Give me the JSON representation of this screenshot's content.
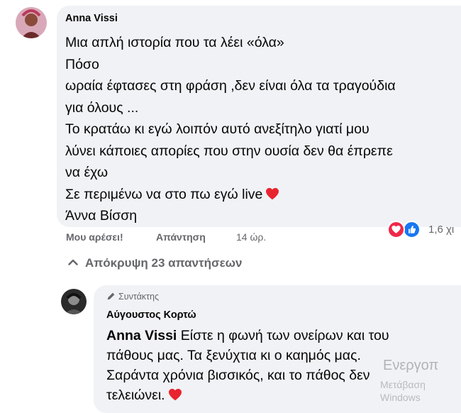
{
  "comment1": {
    "author": "Anna Vissi",
    "lines": [
      "Μια απλή ιστορία που τα λέει «όλα»",
      "Πόσο",
      "ωραία έφτασες στη φράση ,δεν είναι όλα τα τραγούδια",
      "για όλους ...",
      "Το κρατάω κι εγώ λοιπόν αυτό ανεξίτηλο γιατί μου",
      "λύνει κάποιες απορίες που στην ουσία δεν θα έπρεπε",
      "να έχω",
      "Σε περιμένω να στο πω εγώ live",
      "Άννα Βίσση"
    ],
    "actions": {
      "like": "Μου αρέσει!",
      "reply": "Απάντηση",
      "time": "14 ώρ."
    },
    "reactions": {
      "icons": [
        "heart-icon",
        "like-icon"
      ],
      "count": "1,6 χι"
    }
  },
  "hide_replies": "Απόκρυψη 23 απαντήσεων",
  "comment2": {
    "badge": "Συντάκτης",
    "author": "Αύγουστος Κορτώ",
    "mention": "Anna Vissi",
    "lines": [
      " Είστε η φωνή των ονείρων και του",
      "πάθους μας. Τα ξενύχτια κι ο καημός μας.",
      "Σαράντα χρόνια βισσικός, και το πάθος δεν",
      "τελειώνει."
    ]
  },
  "watermark": {
    "line1": "Ενεργοπ",
    "line2": "Μετάβαση",
    "line3": "Windows"
  },
  "colors": {
    "bubble": "#f0f2f5",
    "secondary_text": "#65676b",
    "heart": "#f02849",
    "like": "#1877f2"
  }
}
